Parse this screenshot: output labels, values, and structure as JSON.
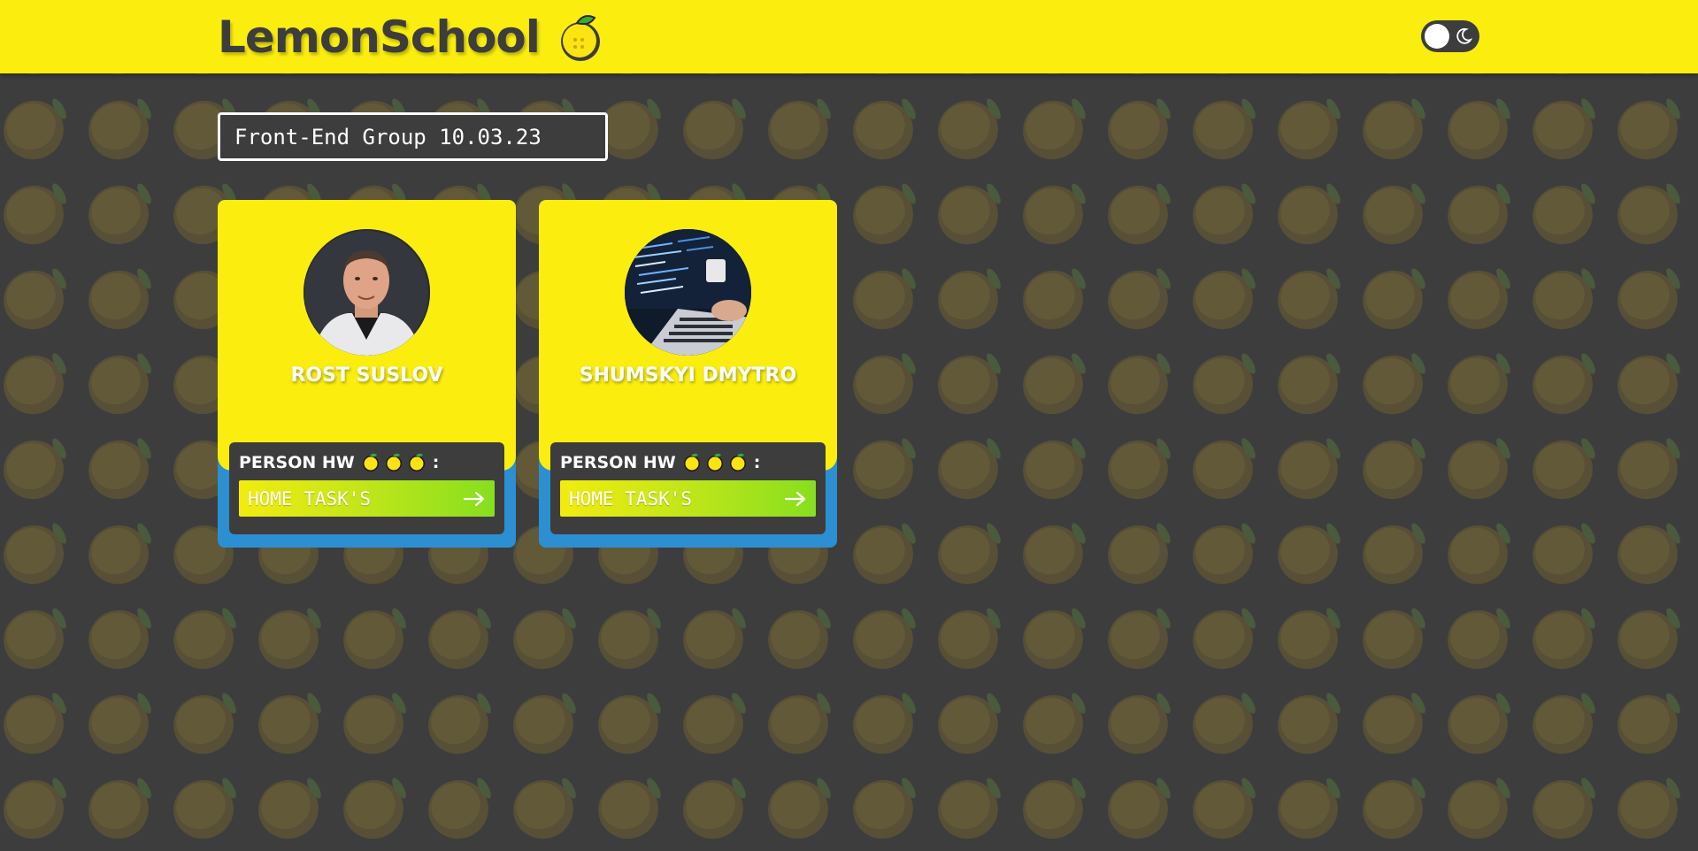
{
  "header": {
    "brand_name": "LemonSchool",
    "brand_icon": "lemon-logo-icon",
    "theme_toggle": {
      "state": "light",
      "icon": "moon-icon"
    }
  },
  "group_select": {
    "selected": "Front-End Group 10.03.23"
  },
  "students": [
    {
      "name": "ROST SUSLOV",
      "avatar": "person-photo",
      "hw_label": "PERSON HW",
      "hw_lemon_count": 3,
      "hw_suffix": ":",
      "tasks_button_label": "HOME TASK'S"
    },
    {
      "name": "SHUMSKYI DMYTRO",
      "avatar": "laptop-code-photo",
      "hw_label": "PERSON HW",
      "hw_lemon_count": 3,
      "hw_suffix": ":",
      "tasks_button_label": "HOME TASK'S"
    }
  ],
  "colors": {
    "brand_yellow": "#fbee0f",
    "background": "#3d3d3d",
    "card_footer_blue": "#2c8fd1",
    "button_green": "#86df1f"
  }
}
